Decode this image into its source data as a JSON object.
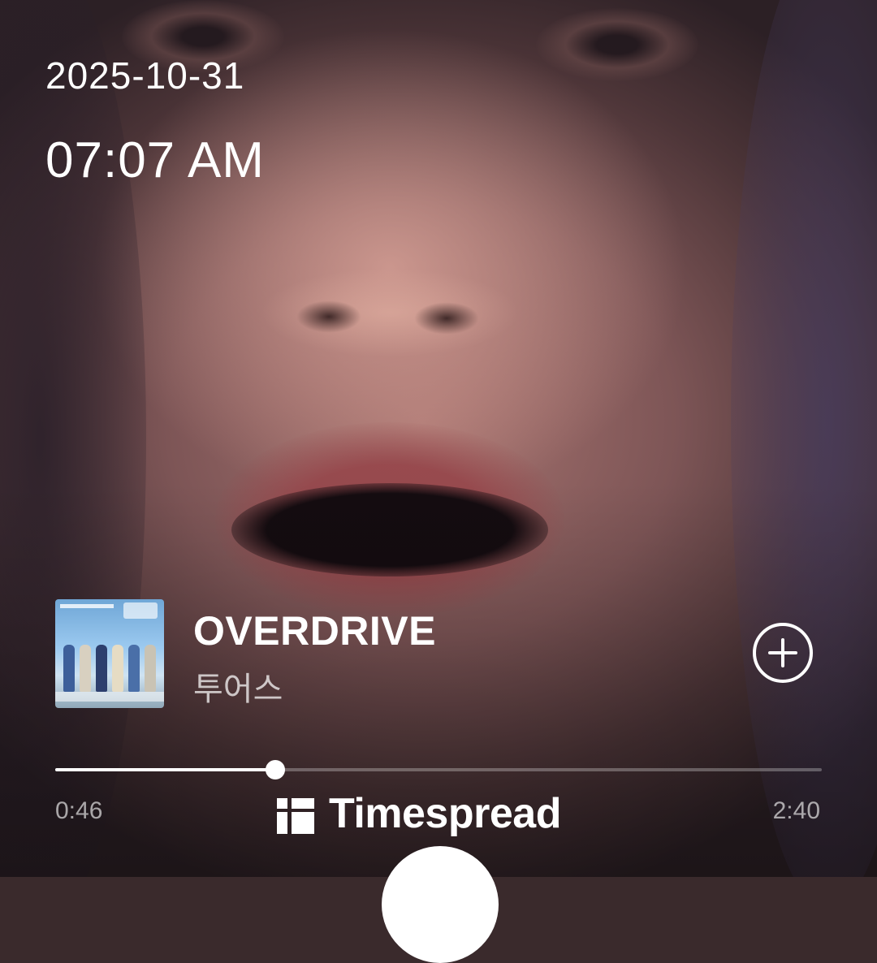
{
  "status": {
    "date": "2025-10-31",
    "time": "07:07 AM"
  },
  "now_playing": {
    "title": "OVERDRIVE",
    "artist": "투어스",
    "album_art_icon": "album-cover-image",
    "add_icon": "plus-circle-icon"
  },
  "progress": {
    "elapsed": "0:46",
    "total": "2:40",
    "fraction": 0.2875
  },
  "brand": {
    "name": "Timespread",
    "icon": "timespread-logo-icon"
  },
  "colors": {
    "text": "#ffffff",
    "track": "rgba(255,255,255,0.28)",
    "fill": "#ffffff"
  }
}
